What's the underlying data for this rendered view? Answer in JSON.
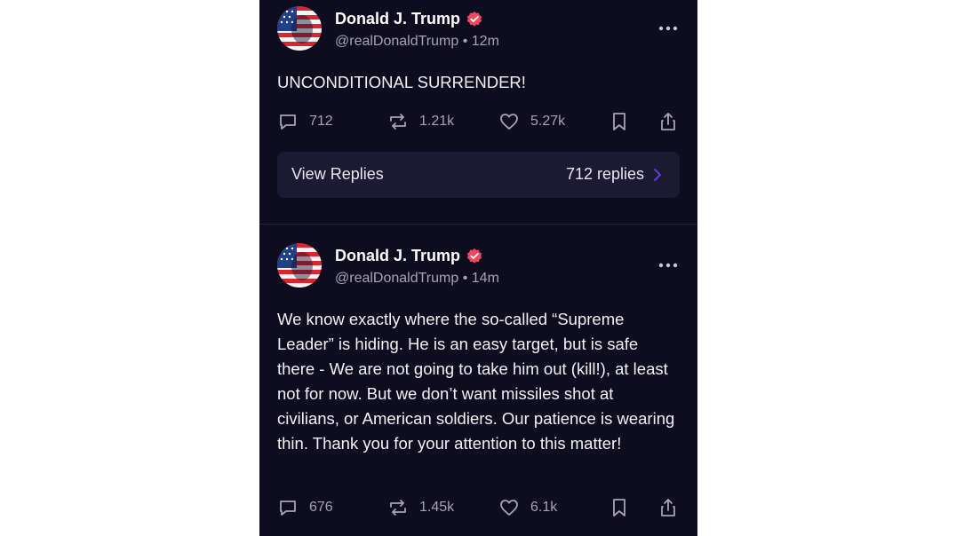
{
  "posts": [
    {
      "author": "Donald J. Trump",
      "handle": "@realDonaldTrump",
      "separator": "•",
      "time": "12m",
      "text": "UNCONDITIONAL SURRENDER!",
      "comments": "712",
      "reposts": "1.21k",
      "likes": "5.27k",
      "view_replies_label": "View Replies",
      "replies_count": "712 replies"
    },
    {
      "author": "Donald J. Trump",
      "handle": "@realDonaldTrump",
      "separator": "•",
      "time": "14m",
      "text": "We know exactly where the so-called “Supreme Leader” is hiding. He is an easy target, but is safe there - We are not going to take him out (kill!), at least not for now. But we don’t want missiles shot at civilians, or American soldiers. Our patience is wearing thin. Thank you for your attention to this matter!",
      "comments": "676",
      "reposts": "1.45k",
      "likes": "6.1k"
    }
  ],
  "colors": {
    "background": "#0e0c1f",
    "card": "#1c1a33",
    "verified_badge": "#f0475f",
    "secondary_text": "#a6a3b6",
    "chevron": "#5b3fd6"
  },
  "icons": [
    "comment-icon",
    "repost-icon",
    "heart-icon",
    "bookmark-icon",
    "share-icon",
    "more-icon",
    "verified-icon",
    "chevron-right-icon"
  ]
}
